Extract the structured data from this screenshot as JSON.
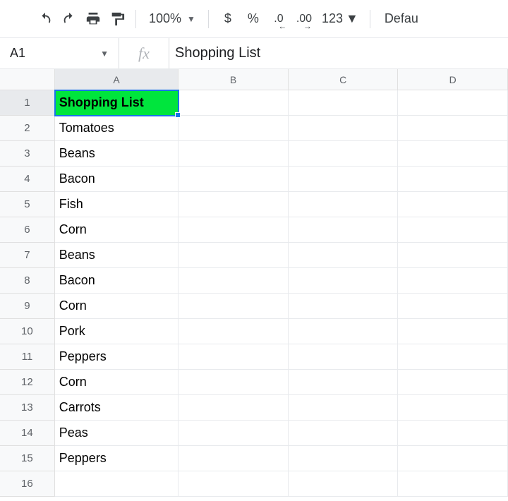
{
  "toolbar": {
    "zoom": "100%",
    "currency": "$",
    "percent": "%",
    "dec_decrease": ".0",
    "dec_increase": ".00",
    "more_formats": "123",
    "font": "Defau"
  },
  "formula_bar": {
    "cell_ref": "A1",
    "fx_label": "fx",
    "value": "Shopping List"
  },
  "columns": [
    "A",
    "B",
    "C",
    "D"
  ],
  "active_col": "A",
  "active_row": 1,
  "rows": [
    {
      "n": 1,
      "a": "Shopping List",
      "header": true,
      "active": true
    },
    {
      "n": 2,
      "a": "Tomatoes"
    },
    {
      "n": 3,
      "a": "Beans"
    },
    {
      "n": 4,
      "a": "Bacon"
    },
    {
      "n": 5,
      "a": "Fish"
    },
    {
      "n": 6,
      "a": "Corn"
    },
    {
      "n": 7,
      "a": "Beans"
    },
    {
      "n": 8,
      "a": "Bacon"
    },
    {
      "n": 9,
      "a": "Corn"
    },
    {
      "n": 10,
      "a": "Pork"
    },
    {
      "n": 11,
      "a": "Peppers"
    },
    {
      "n": 12,
      "a": "Corn"
    },
    {
      "n": 13,
      "a": "Carrots"
    },
    {
      "n": 14,
      "a": "Peas"
    },
    {
      "n": 15,
      "a": "Peppers"
    },
    {
      "n": 16,
      "a": ""
    }
  ]
}
